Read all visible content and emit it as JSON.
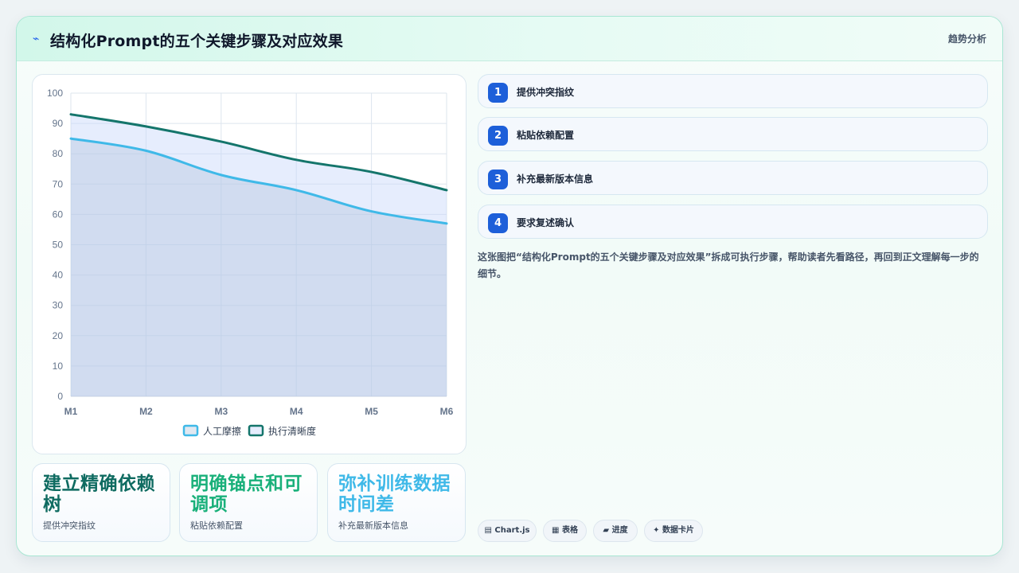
{
  "header": {
    "icon": "trend-icon",
    "title": "结构化Prompt的五个关键步骤及对应效果",
    "link": "趋势分析"
  },
  "chart_data": {
    "type": "area",
    "x": [
      "M1",
      "M2",
      "M3",
      "M4",
      "M5",
      "M6"
    ],
    "ylim": [
      0,
      100
    ],
    "yticks": [
      0,
      10,
      20,
      30,
      40,
      50,
      60,
      70,
      80,
      90,
      100
    ],
    "grid": true,
    "legend_position": "bottom",
    "series": [
      {
        "name": "人工摩擦",
        "values": [
          85,
          81,
          73,
          68,
          61,
          57
        ],
        "color": "#3fb9e8",
        "fill": "rgba(170,190,215,0.35)"
      },
      {
        "name": "执行清晰度",
        "values": [
          93,
          89,
          84,
          78,
          74,
          68
        ],
        "color": "#14756b",
        "fill": "rgba(200,215,250,0.45)"
      }
    ]
  },
  "stats": [
    {
      "value": "建立精确依赖树",
      "label": "提供冲突指纹",
      "color": "#0f6b61"
    },
    {
      "value": "明确锚点和可调项",
      "label": "粘贴依赖配置",
      "color": "#19b07a"
    },
    {
      "value": "弥补训练数据时间差",
      "label": "补充最新版本信息",
      "color": "#3fb9e8"
    }
  ],
  "steps": [
    {
      "num": "1",
      "label": "提供冲突指纹"
    },
    {
      "num": "2",
      "label": "粘贴依赖配置"
    },
    {
      "num": "3",
      "label": "补充最新版本信息"
    },
    {
      "num": "4",
      "label": "要求复述确认"
    }
  ],
  "description": "这张图把“结构化Prompt的五个关键步骤及对应效果”拆成可执行步骤，帮助读者先看路径，再回到正文理解每一步的细节。",
  "tags": [
    {
      "icon": "▤",
      "label": "Chart.js"
    },
    {
      "icon": "▦",
      "label": "表格"
    },
    {
      "icon": "▰",
      "label": "进度"
    },
    {
      "icon": "✦",
      "label": "数据卡片"
    }
  ]
}
